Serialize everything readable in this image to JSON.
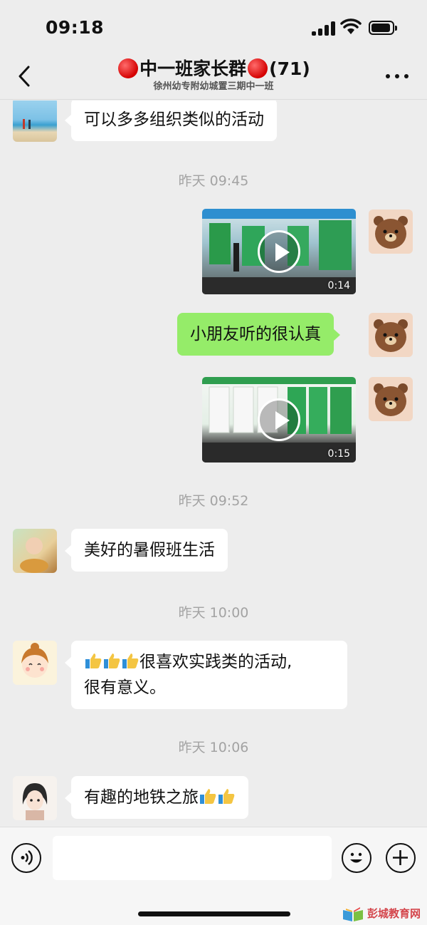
{
  "status_bar": {
    "time": "09:18"
  },
  "header": {
    "back_label": "back",
    "title": "中一班家长群",
    "member_count": "(71)",
    "subtitle": "徐州幼专附幼城置三期中一班"
  },
  "messages": {
    "m1_text": "可以多多组织类似的活动",
    "ts1": "昨天 09:45",
    "v1_duration": "0:14",
    "m2_text": "小朋友听的很认真",
    "v2_duration": "0:15",
    "ts2": "昨天 09:52",
    "m3_text": "美好的暑假班生活",
    "ts3": "昨天 10:00",
    "m4_line1": "很喜欢实践类的活动,",
    "m4_line2": "很有意义。",
    "ts4": "昨天 10:06",
    "m5_text": "有趣的地铁之旅"
  },
  "input_bar": {
    "placeholder": ""
  },
  "watermark": {
    "text": "彭城教育网"
  },
  "colors": {
    "background": "#ededed",
    "bubble_self": "#95ec69",
    "bubble_other": "#ffffff",
    "timestamp": "#a3a3a3"
  }
}
